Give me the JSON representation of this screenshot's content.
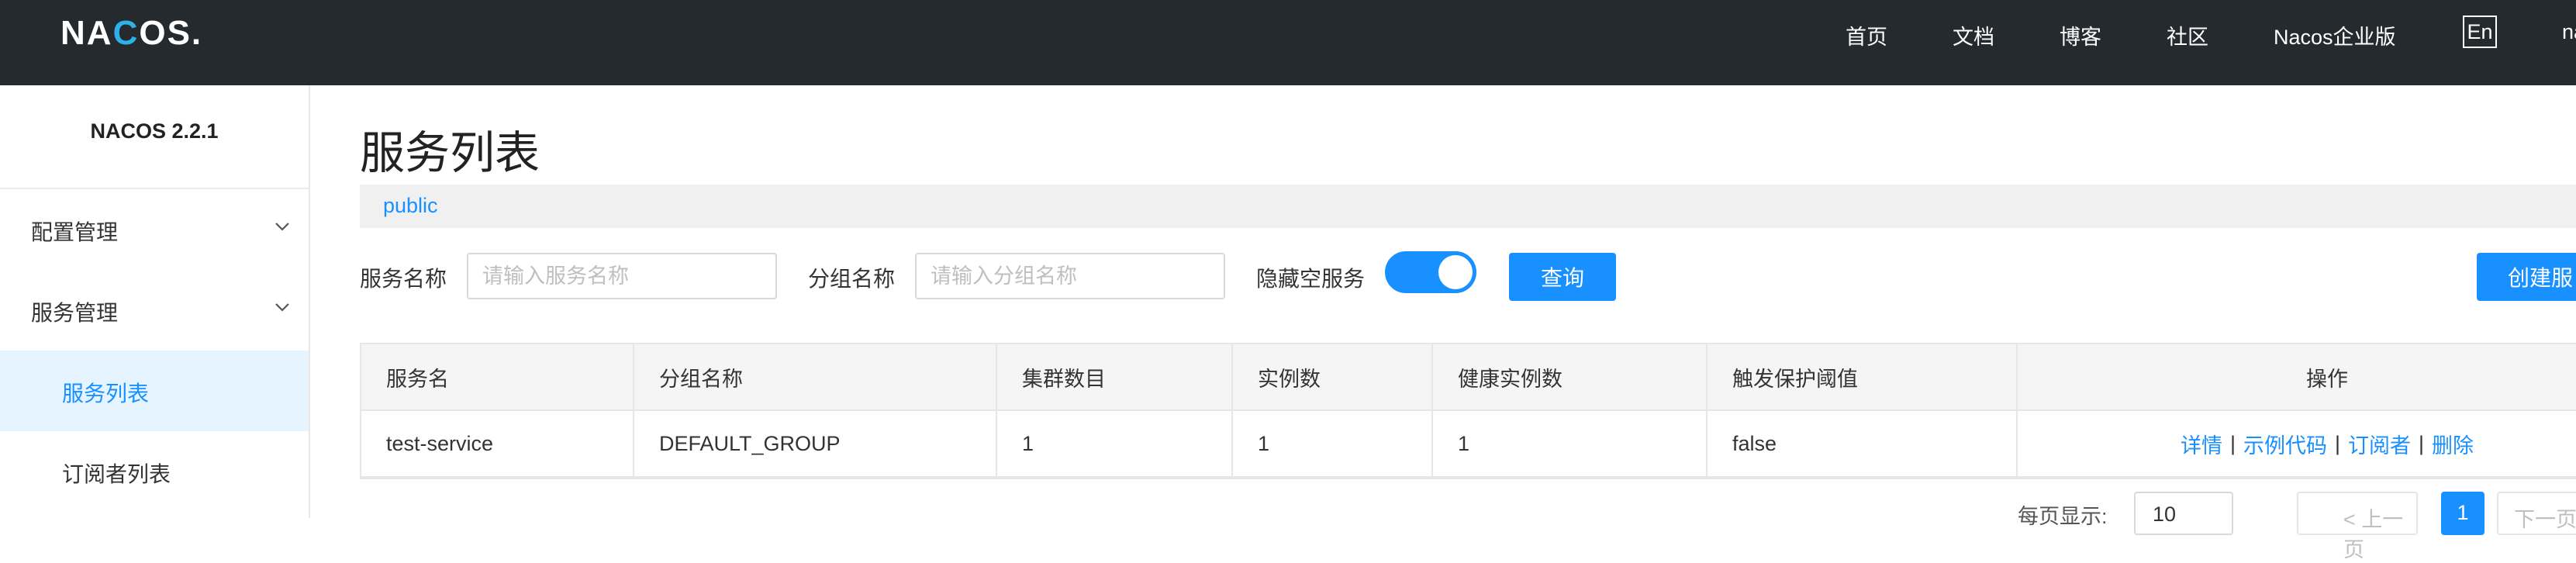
{
  "header": {
    "logo": {
      "prefix": "NA",
      "accent": "C",
      "suffix": "OS.",
      "accent_color": "#2fb1e8"
    },
    "nav": [
      {
        "label": "首页"
      },
      {
        "label": "文档"
      },
      {
        "label": "博客"
      },
      {
        "label": "社区"
      },
      {
        "label": "Nacos企业版"
      }
    ],
    "lang_button": "En",
    "cut_text": "na"
  },
  "sidebar": {
    "version": "NACOS 2.2.1",
    "groups": [
      {
        "label": "配置管理"
      },
      {
        "label": "服务管理"
      }
    ],
    "items": [
      {
        "label": "服务列表",
        "active": true
      },
      {
        "label": "订阅者列表",
        "active": false
      }
    ]
  },
  "main": {
    "title": "服务列表",
    "namespace": "public",
    "filters": {
      "service_name_label": "服务名称",
      "service_name_placeholder": "请输入服务名称",
      "group_name_label": "分组名称",
      "group_name_placeholder": "请输入分组名称",
      "hide_empty_label": "隐藏空服务",
      "hide_empty_on": true,
      "query_button": "查询",
      "create_button": "创建服"
    },
    "table": {
      "columns": [
        "服务名",
        "分组名称",
        "集群数目",
        "实例数",
        "健康实例数",
        "触发保护阈值",
        "操作"
      ],
      "rows": [
        {
          "name": "test-service",
          "group": "DEFAULT_GROUP",
          "clusters": "1",
          "instances": "1",
          "healthy": "1",
          "threshold": "false",
          "actions": [
            "详情",
            "示例代码",
            "订阅者",
            "删除"
          ]
        }
      ]
    },
    "pagination": {
      "per_page_label": "每页显示:",
      "per_page_value": "10",
      "prev": "< 上一页",
      "current": "1",
      "next": "下一页"
    }
  },
  "colors": {
    "topbar": "#252a2f",
    "primary": "#1890ff",
    "active_bg": "#e6f4ff"
  }
}
